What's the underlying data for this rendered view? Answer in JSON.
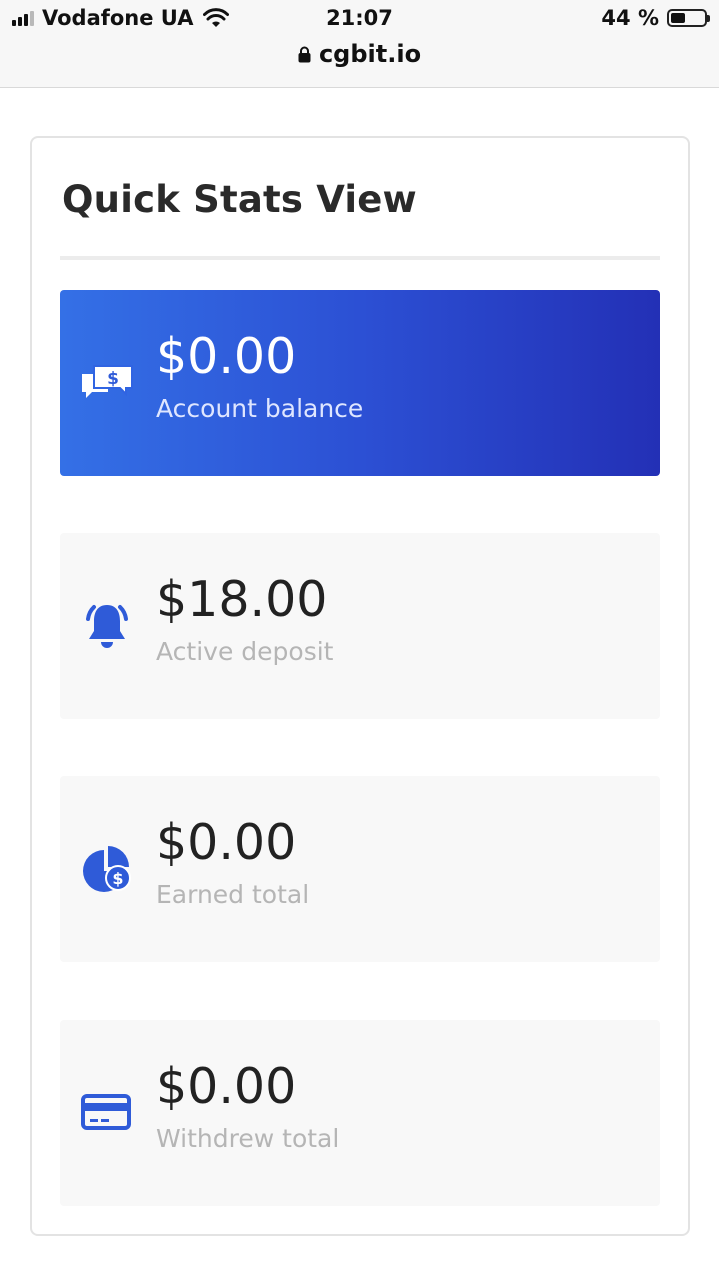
{
  "status_bar": {
    "carrier": "Vodafone UA",
    "time": "21:07",
    "battery_text": "44 %",
    "battery_level": 0.44
  },
  "browser": {
    "url": "cgbit.io"
  },
  "panel": {
    "title": "Quick Stats View"
  },
  "stats": [
    {
      "value": "$0.00",
      "label": "Account balance",
      "icon": "money-chat-icon"
    },
    {
      "value": "$18.00",
      "label": "Active deposit",
      "icon": "bell-icon"
    },
    {
      "value": "$0.00",
      "label": "Earned total",
      "icon": "pie-dollar-icon"
    },
    {
      "value": "$0.00",
      "label": "Withdrew total",
      "icon": "credit-card-icon"
    }
  ],
  "colors": {
    "accent_start": "#3470e6",
    "accent_end": "#2330b6",
    "icon_blue": "#2f5bd8"
  }
}
